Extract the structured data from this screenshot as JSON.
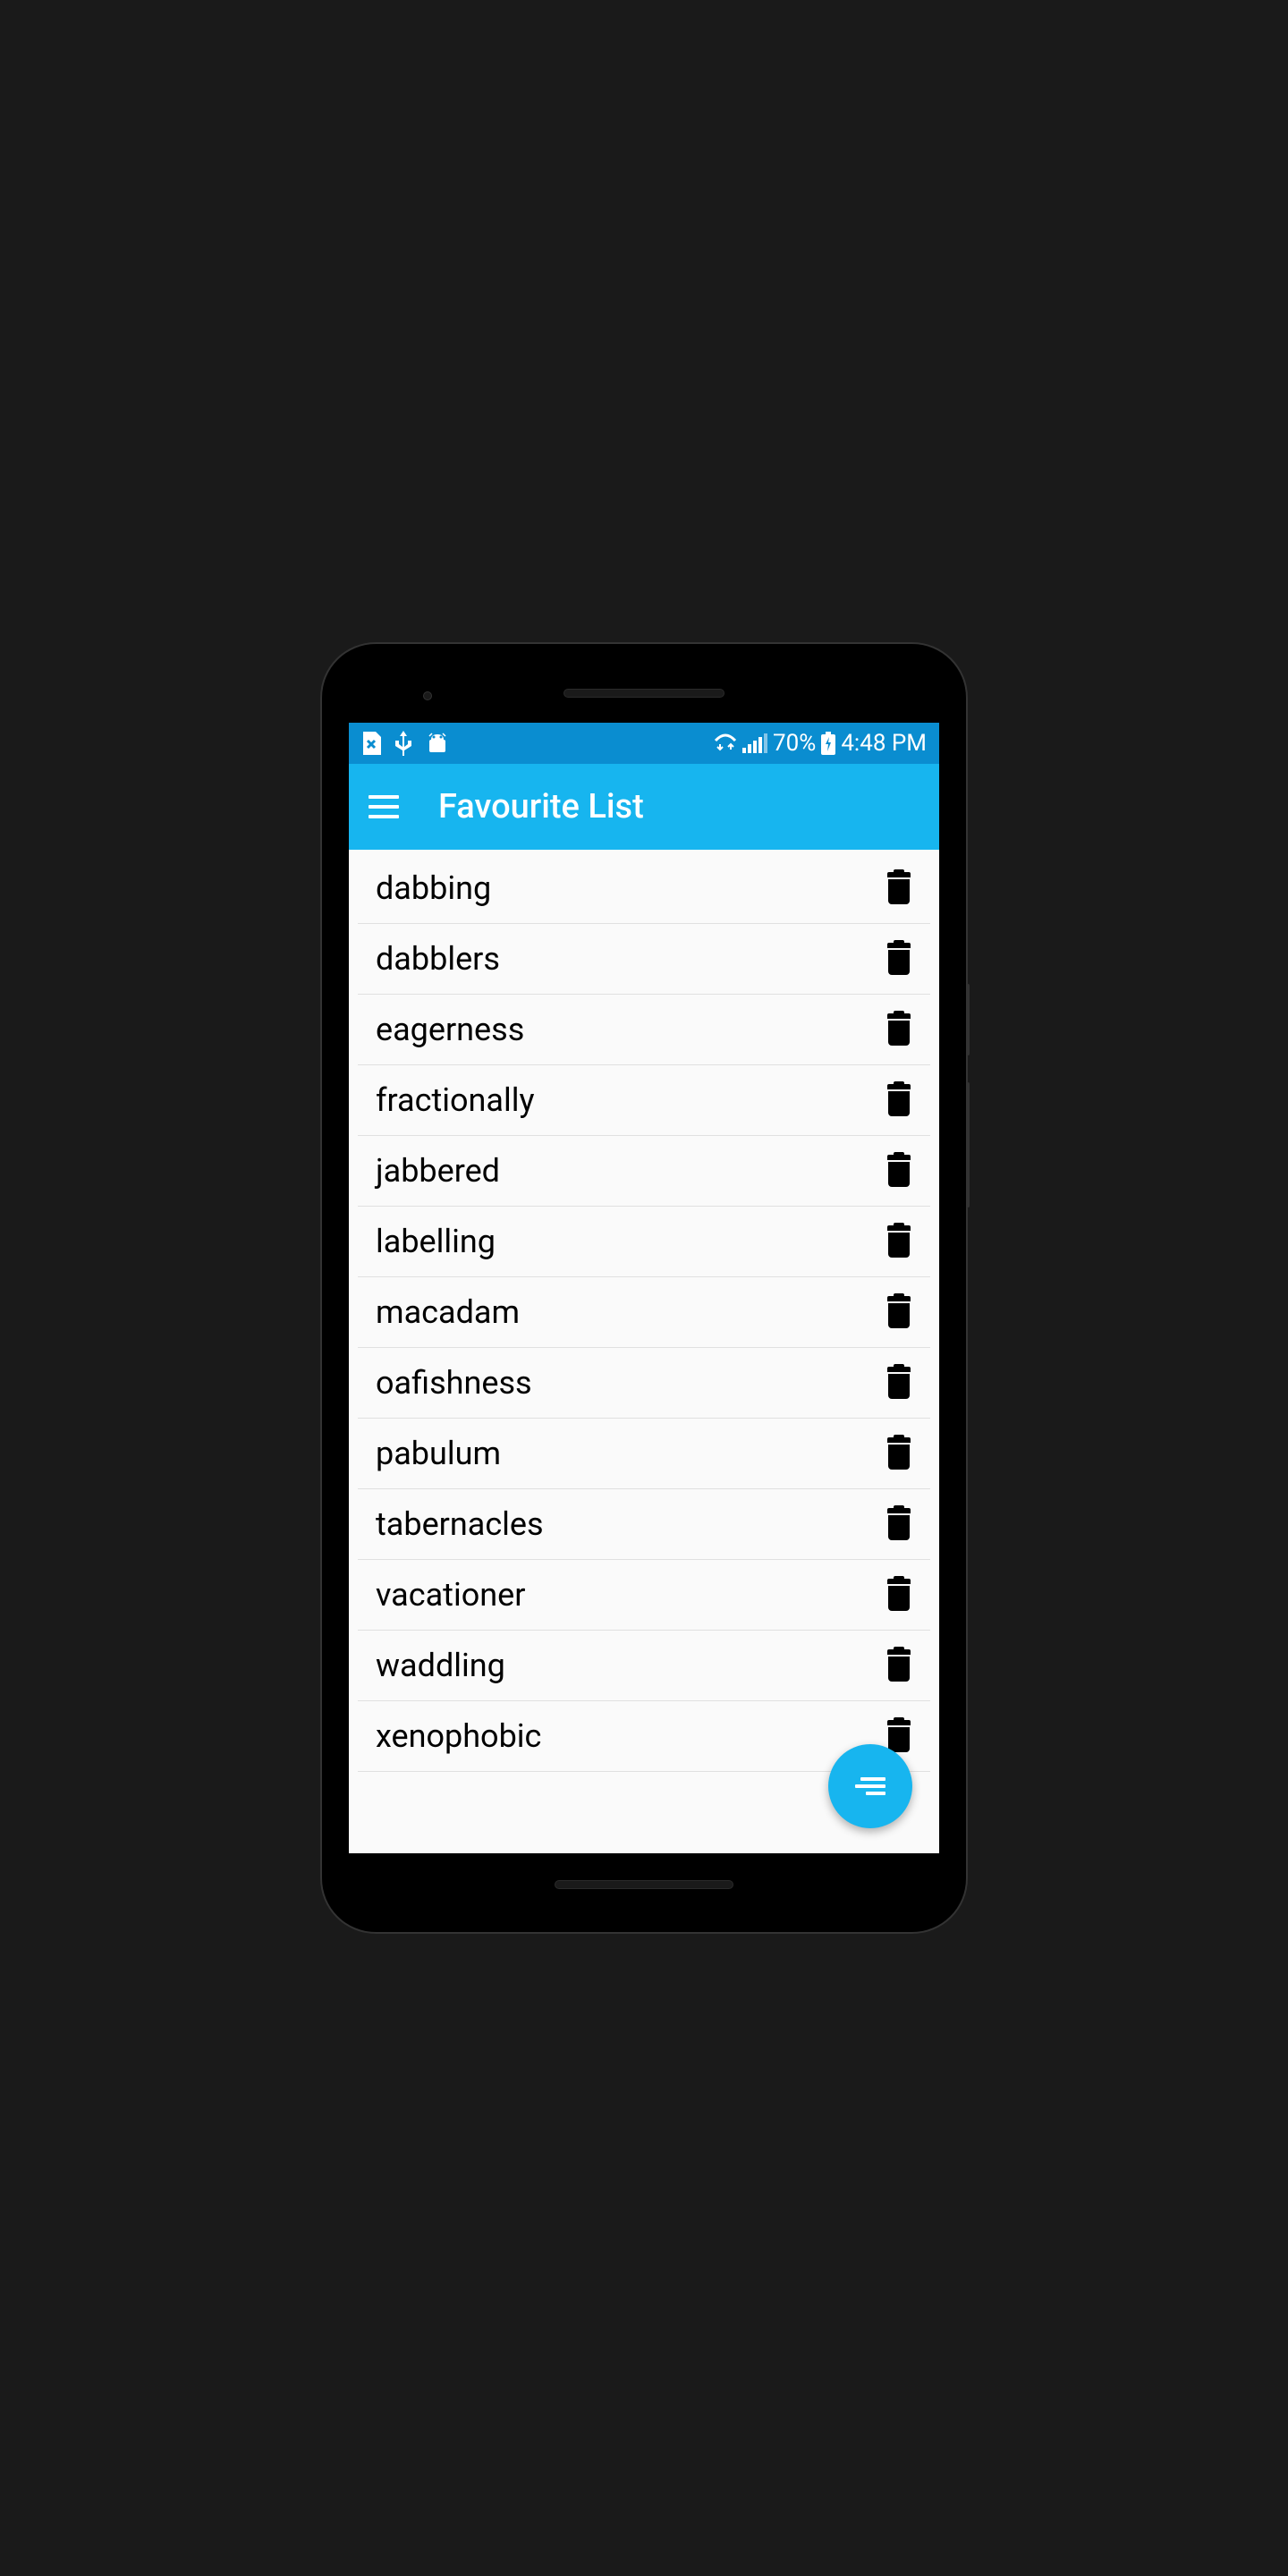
{
  "status": {
    "battery_percent": "70%",
    "time": "4:48 PM"
  },
  "appbar": {
    "title": "Favourite List"
  },
  "favourites": [
    {
      "word": "dabbing"
    },
    {
      "word": "dabblers"
    },
    {
      "word": "eagerness"
    },
    {
      "word": "fractionally"
    },
    {
      "word": "jabbered"
    },
    {
      "word": "labelling"
    },
    {
      "word": "macadam"
    },
    {
      "word": "oafishness"
    },
    {
      "word": "pabulum"
    },
    {
      "word": "tabernacles"
    },
    {
      "word": "vacationer"
    },
    {
      "word": "waddling"
    },
    {
      "word": "xenophobic"
    }
  ],
  "colors": {
    "status_bar": "#0a8dd0",
    "app_bar": "#17b5ef",
    "fab": "#17b5ef"
  }
}
